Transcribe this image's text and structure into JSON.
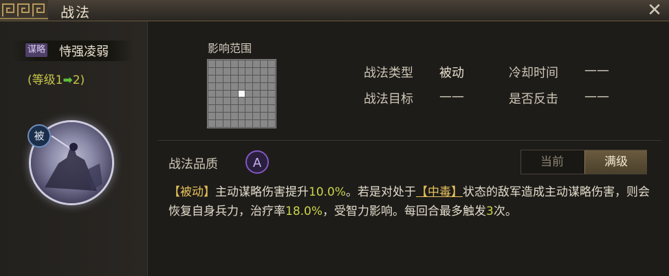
{
  "window": {
    "title": "战法"
  },
  "skill": {
    "tag": "谋略",
    "name": "恃强凌弱",
    "level_prefix": "(等级1",
    "level_arrow": "➡",
    "level_suffix": "2)",
    "badge": "被"
  },
  "range": {
    "label": "影响范围",
    "grid_size": 9,
    "center_index": 40
  },
  "info": {
    "type_label": "战法类型",
    "type_value": "被动",
    "cooldown_label": "冷却时间",
    "cooldown_value": "——",
    "target_label": "战法目标",
    "target_value": "——",
    "counter_label": "是否反击",
    "counter_value": "——"
  },
  "quality": {
    "label": "战法品质",
    "grade": "A"
  },
  "toggle": {
    "current": "当前",
    "max": "满级",
    "selected": "max"
  },
  "description": {
    "p1": "【被动】",
    "p2": "主动谋略伤害提升",
    "p3": "10.0%",
    "p4": "。若是对处于",
    "p5": "【中毒】",
    "p6": "状态的敌军造成主动谋略伤害，则会恢复自身兵力，治疗率",
    "p7": "18.0%",
    "p8": "，受智力影响。每回合最多触发",
    "p9": "3",
    "p10": "次。"
  },
  "colors": {
    "highlight": "#e6c15a",
    "number": "#c9d64a",
    "quality": "#8258c4"
  }
}
